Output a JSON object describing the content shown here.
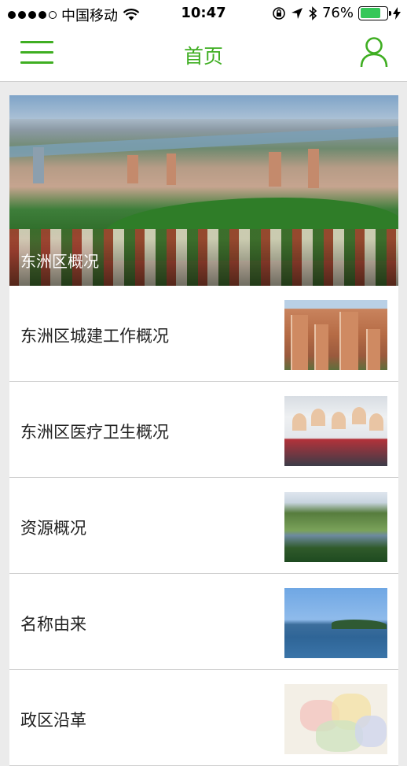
{
  "status_bar": {
    "carrier": "中国移动",
    "time": "10:47",
    "battery_percent": "76%",
    "battery_level": 0.76,
    "battery_color": "#35c759"
  },
  "nav": {
    "title": "首页",
    "menu_icon": "menu-icon",
    "user_icon": "user-icon",
    "accent_color": "#3fae22"
  },
  "hero": {
    "caption": "东洲区概况"
  },
  "list": [
    {
      "label": "东洲区城建工作概况",
      "thumbnail": "city-buildings-photo"
    },
    {
      "label": "东洲区医疗卫生概况",
      "thumbnail": "medical-staff-photo"
    },
    {
      "label": "资源概况",
      "thumbnail": "reservoir-landscape-photo"
    },
    {
      "label": "名称由来",
      "thumbnail": "sea-island-photo"
    },
    {
      "label": "政区沿革",
      "thumbnail": "district-map-image"
    }
  ]
}
